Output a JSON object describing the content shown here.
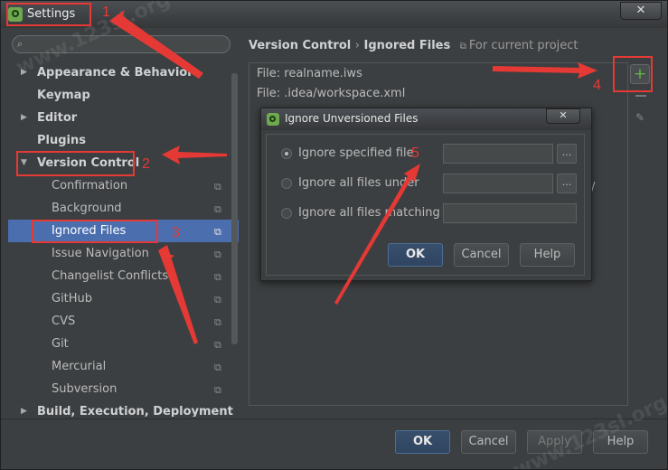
{
  "window": {
    "title": "Settings",
    "close_label": "✕"
  },
  "search": {
    "icon": "search-icon"
  },
  "tree": {
    "appearance": "Appearance & Behavior",
    "keymap": "Keymap",
    "editor": "Editor",
    "plugins": "Plugins",
    "version_control": "Version Control",
    "children": [
      "Confirmation",
      "Background",
      "Ignored Files",
      "Issue Navigation",
      "Changelist Conflicts",
      "GitHub",
      "CVS",
      "Git",
      "Mercurial",
      "Subversion"
    ],
    "build": "Build, Execution, Deployment"
  },
  "header": {
    "parent": "Version Control",
    "separator": "›",
    "current": "Ignored Files",
    "scope": "For current project"
  },
  "files": [
    "File: realname.iws",
    "File: .idea/workspace.xml"
  ],
  "partial_text": "/",
  "dialog": {
    "title": "Ignore Unversioned Files",
    "close_label": "✕",
    "option1": "Ignore specified file",
    "option2": "Ignore all files under",
    "option3": "Ignore all files matching",
    "browse_label": "...",
    "ok": "OK",
    "cancel": "Cancel",
    "help": "Help"
  },
  "buttons": {
    "ok": "OK",
    "cancel": "Cancel",
    "apply": "Apply",
    "help": "Help"
  },
  "annotations": [
    "1",
    "2",
    "3",
    "4",
    "5"
  ],
  "watermark": "www.123sl.org",
  "colors": {
    "annotation": "#e53935",
    "selection": "#4b6eaf",
    "add": "#62b543"
  }
}
